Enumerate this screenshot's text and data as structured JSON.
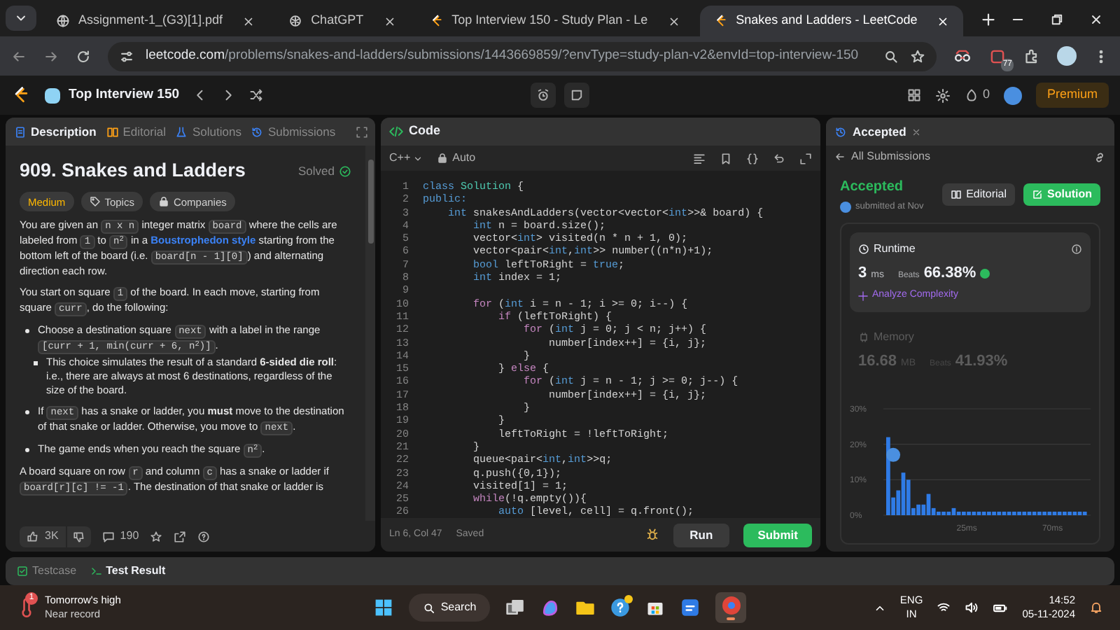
{
  "browser": {
    "tabs": [
      {
        "title": "Assignment-1_(G3)[1].pdf",
        "kind": "globe",
        "selected": false
      },
      {
        "title": "ChatGPT",
        "kind": "chat",
        "selected": false
      },
      {
        "title": "Top Interview 150 - Study Plan - Le",
        "kind": "leetcode",
        "selected": false
      },
      {
        "title": "Snakes and Ladders - LeetCode",
        "kind": "leetcode",
        "selected": true
      }
    ],
    "url_host": "leetcode.com",
    "url_path": "/problems/snakes-and-ladders/submissions/1443669859/?envType=study-plan-v2&envId=top-interview-150",
    "extension_badge": "77"
  },
  "topbar": {
    "title": "Top Interview 150",
    "streak": "0",
    "premium": "Premium"
  },
  "left_panel": {
    "tabs": [
      {
        "label": "Description",
        "selected": true
      },
      {
        "label": "Editorial",
        "selected": false
      },
      {
        "label": "Solutions",
        "selected": false
      },
      {
        "label": "Submissions",
        "selected": false
      }
    ],
    "title": "909. Snakes and Ladders",
    "solved": "Solved",
    "tags": [
      {
        "label": "Medium",
        "kind": "difficulty"
      },
      {
        "label": "Topics",
        "kind": "topics"
      },
      {
        "label": "Companies",
        "kind": "companies"
      }
    ],
    "blocks": [
      {
        "kind": "paragraph",
        "segments": [
          {
            "kind": "text",
            "text": "You are given an "
          },
          {
            "kind": "code",
            "text": "n x n"
          },
          {
            "kind": "text",
            "text": " integer matrix "
          },
          {
            "kind": "code",
            "text": "board"
          },
          {
            "kind": "text",
            "text": " where the cells are labeled from "
          },
          {
            "kind": "code",
            "text": "1"
          },
          {
            "kind": "text",
            "text": " to "
          },
          {
            "kind": "code",
            "text": "n$^{2}$"
          },
          {
            "kind": "text",
            "text": " in a "
          },
          {
            "kind": "link",
            "text": "Boustrophedon style"
          },
          {
            "kind": "text",
            "text": " starting from the bottom left of the board (i.e. "
          },
          {
            "kind": "code",
            "text": "board[n - 1][0]"
          },
          {
            "kind": "text",
            "text": ") and alternating direction each row."
          }
        ]
      },
      {
        "kind": "paragraph",
        "segments": [
          {
            "kind": "text",
            "text": "You start on square "
          },
          {
            "kind": "code",
            "text": "1"
          },
          {
            "kind": "text",
            "text": " of the board. In each move, starting from square "
          },
          {
            "kind": "code",
            "text": "curr"
          },
          {
            "kind": "text",
            "text": ", do the following:"
          }
        ]
      },
      {
        "kind": "bullet",
        "segments": [
          {
            "kind": "text",
            "text": "Choose a destination square "
          },
          {
            "kind": "code",
            "text": "next"
          },
          {
            "kind": "text",
            "text": " with a label in the range "
          },
          {
            "kind": "code",
            "text": "[curr + 1, min(curr + 6, n$^{2}$)]"
          },
          {
            "kind": "text",
            "text": "."
          }
        ],
        "children": [
          {
            "kind": "bullet",
            "segments": [
              {
                "kind": "text",
                "text": "This choice simulates the result of a standard **6-sided die roll**: i.e., there are always at most 6 destinations, regardless of the size of the board."
              }
            ]
          }
        ]
      },
      {
        "kind": "bullet",
        "segments": [
          {
            "kind": "text",
            "text": "If "
          },
          {
            "kind": "code",
            "text": "next"
          },
          {
            "kind": "text",
            "text": " has a snake or ladder, you **must** move to the destination of that snake or ladder. Otherwise, you move to "
          },
          {
            "kind": "code",
            "text": "next"
          },
          {
            "kind": "text",
            "text": "."
          }
        ]
      },
      {
        "kind": "bullet",
        "segments": [
          {
            "kind": "text",
            "text": "The game ends when you reach the square "
          },
          {
            "kind": "code",
            "text": "n$^{2}$"
          },
          {
            "kind": "text",
            "text": "."
          }
        ]
      },
      {
        "kind": "paragraph",
        "segments": [
          {
            "kind": "text",
            "text": "A board square on row "
          },
          {
            "kind": "code",
            "text": "r"
          },
          {
            "kind": "text",
            "text": " and column "
          },
          {
            "kind": "code",
            "text": "c"
          },
          {
            "kind": "text",
            "text": " has a snake or ladder if "
          },
          {
            "kind": "code",
            "text": "board[r][c] != -1"
          },
          {
            "kind": "text",
            "text": ". The destination of that snake or ladder is"
          }
        ]
      }
    ],
    "likes": "3K",
    "comments": "190"
  },
  "code_panel": {
    "title": "Code",
    "language": "C++",
    "mode": "Auto",
    "lines": [
      {
        "n": "1",
        "tokens": [
          {
            "text": "class",
            "kind": "keyword"
          },
          {
            "text": " Solution",
            "kind": "type"
          },
          {
            "text": " {",
            "kind": "plain"
          }
        ]
      },
      {
        "n": "2",
        "tokens": [
          {
            "text": "public:",
            "kind": "keyword"
          }
        ]
      },
      {
        "n": "3",
        "tokens": [
          {
            "text": "    int",
            "kind": "keyword"
          },
          {
            "text": " snakesAndLadders(vector<vector<",
            "kind": "plain"
          },
          {
            "text": "int",
            "kind": "keyword"
          },
          {
            "text": ">>& board) {",
            "kind": "plain"
          }
        ]
      },
      {
        "n": "4",
        "tokens": [
          {
            "text": "        int",
            "kind": "keyword"
          },
          {
            "text": " n = board.size();",
            "kind": "plain"
          }
        ]
      },
      {
        "n": "5",
        "tokens": [
          {
            "text": "        vector<",
            "kind": "plain"
          },
          {
            "text": "int",
            "kind": "keyword"
          },
          {
            "text": "> visited(n * n + 1, 0);",
            "kind": "plain"
          }
        ]
      },
      {
        "n": "6",
        "tokens": [
          {
            "text": "        vector<pair<",
            "kind": "plain"
          },
          {
            "text": "int",
            "kind": "keyword"
          },
          {
            "text": ",",
            "kind": "plain"
          },
          {
            "text": "int",
            "kind": "keyword"
          },
          {
            "text": ">> number((n*n)+1);",
            "kind": "plain"
          }
        ]
      },
      {
        "n": "7",
        "tokens": [
          {
            "text": "        bool",
            "kind": "keyword"
          },
          {
            "text": " leftToRight = ",
            "kind": "plain"
          },
          {
            "text": "true",
            "kind": "keyword"
          },
          {
            "text": ";",
            "kind": "plain"
          }
        ]
      },
      {
        "n": "8",
        "tokens": [
          {
            "text": "        int",
            "kind": "keyword"
          },
          {
            "text": " index = 1;",
            "kind": "plain"
          }
        ]
      },
      {
        "n": "9"
      },
      {
        "n": "10",
        "tokens": [
          {
            "text": "        for",
            "kind": "control"
          },
          {
            "text": " (",
            "kind": "plain"
          },
          {
            "text": "int",
            "kind": "keyword"
          },
          {
            "text": " i = n - 1; i >= 0; i--) {",
            "kind": "plain"
          }
        ]
      },
      {
        "n": "11",
        "tokens": [
          {
            "text": "            if",
            "kind": "control"
          },
          {
            "text": " (leftToRight) {",
            "kind": "plain"
          }
        ]
      },
      {
        "n": "12",
        "tokens": [
          {
            "text": "                for",
            "kind": "control"
          },
          {
            "text": " (",
            "kind": "plain"
          },
          {
            "text": "int",
            "kind": "keyword"
          },
          {
            "text": " j = 0; j < n; j++) {",
            "kind": "plain"
          }
        ]
      },
      {
        "n": "13",
        "tokens": [
          {
            "text": "                    number[index++] = {i, j};",
            "kind": "plain"
          }
        ]
      },
      {
        "n": "14",
        "tokens": [
          {
            "text": "                }",
            "kind": "plain"
          }
        ]
      },
      {
        "n": "15",
        "tokens": [
          {
            "text": "            } ",
            "kind": "plain"
          },
          {
            "text": "else",
            "kind": "control"
          },
          {
            "text": " {",
            "kind": "plain"
          }
        ]
      },
      {
        "n": "16",
        "tokens": [
          {
            "text": "                for",
            "kind": "control"
          },
          {
            "text": " (",
            "kind": "plain"
          },
          {
            "text": "int",
            "kind": "keyword"
          },
          {
            "text": " j = n - 1; j >= 0; j--) {",
            "kind": "plain"
          }
        ]
      },
      {
        "n": "17",
        "tokens": [
          {
            "text": "                    number[index++] = {i, j};",
            "kind": "plain"
          }
        ]
      },
      {
        "n": "18",
        "tokens": [
          {
            "text": "                }",
            "kind": "plain"
          }
        ]
      },
      {
        "n": "19",
        "tokens": [
          {
            "text": "            }",
            "kind": "plain"
          }
        ]
      },
      {
        "n": "20",
        "tokens": [
          {
            "text": "            leftToRight = !leftToRight;",
            "kind": "plain"
          }
        ]
      },
      {
        "n": "21",
        "tokens": [
          {
            "text": "        }",
            "kind": "plain"
          }
        ]
      },
      {
        "n": "22",
        "tokens": [
          {
            "text": "        queue<pair<",
            "kind": "plain"
          },
          {
            "text": "int",
            "kind": "keyword"
          },
          {
            "text": ",",
            "kind": "plain"
          },
          {
            "text": "int",
            "kind": "keyword"
          },
          {
            "text": ">>q;",
            "kind": "plain"
          }
        ]
      },
      {
        "n": "23",
        "tokens": [
          {
            "text": "        q.push({0,1});",
            "kind": "plain"
          }
        ]
      },
      {
        "n": "24",
        "tokens": [
          {
            "text": "        visited[1] = 1;",
            "kind": "plain"
          }
        ]
      },
      {
        "n": "25",
        "tokens": [
          {
            "text": "        while",
            "kind": "control"
          },
          {
            "text": "(!q.empty()){",
            "kind": "plain"
          }
        ]
      },
      {
        "n": "26",
        "tokens": [
          {
            "text": "            auto",
            "kind": "keyword"
          },
          {
            "text": " [level, cell] = q.front();",
            "kind": "plain"
          }
        ]
      }
    ],
    "position": "Ln 6, Col 47",
    "saved": "Saved",
    "run": "Run",
    "submit": "Submit"
  },
  "result_panel": {
    "tab": "Accepted",
    "back": "All Submissions",
    "status": "Accepted",
    "submitted": "submitted at Nov",
    "editorial": "Editorial",
    "solution": "Solution",
    "metrics": [
      {
        "kind": "runtime",
        "label": "Runtime",
        "value": "3",
        "unit": "ms",
        "beats_label": "Beats",
        "beats": "66.38%",
        "analyze": "Analyze Complexity",
        "selected": true
      },
      {
        "kind": "memory",
        "label": "Memory",
        "value": "16.68",
        "unit": "MB",
        "beats_label": "Beats",
        "beats": "41.93%",
        "selected": false
      }
    ],
    "chart_data": {
      "type": "bar",
      "ylim": [
        0,
        30
      ],
      "yticks": [
        {
          "value": 0,
          "label": "0%"
        },
        {
          "value": 10,
          "label": "10%"
        },
        {
          "value": 20,
          "label": "20%"
        },
        {
          "value": 30,
          "label": "30%"
        }
      ],
      "categories": [
        null,
        null,
        null,
        null,
        null,
        null,
        null,
        null,
        null,
        null,
        null,
        null,
        null,
        null,
        null,
        null,
        "25ms",
        null,
        null,
        null,
        null,
        null,
        null,
        null,
        null,
        null,
        null,
        null,
        null,
        null,
        null,
        null,
        null,
        "70ms",
        null,
        null,
        null,
        null,
        null,
        null
      ],
      "values": [
        22,
        5,
        7,
        12,
        10,
        2,
        3,
        3,
        6,
        2,
        1,
        1,
        1,
        2,
        1,
        1,
        1,
        1,
        1,
        1,
        1,
        1,
        1,
        1,
        1,
        1,
        1,
        1,
        1,
        1,
        1,
        1,
        1,
        1,
        1,
        1,
        1,
        1,
        1,
        1
      ]
    }
  },
  "bottom_tabs": [
    {
      "label": "Testcase",
      "selected": false
    },
    {
      "label": "Test Result",
      "selected": true
    }
  ],
  "taskbar": {
    "weather_badge": "1",
    "weather_title": "Tomorrow's high",
    "weather_subtitle": "Near record",
    "search": "Search",
    "language": "ENG",
    "region": "IN",
    "time": "14:52",
    "date": "05-11-2024"
  }
}
